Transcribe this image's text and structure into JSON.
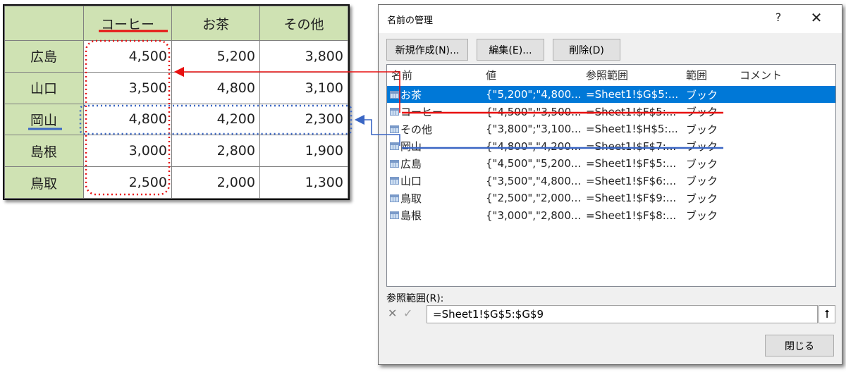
{
  "sheet": {
    "headers": [
      "",
      "コーヒー",
      "お茶",
      "その他"
    ],
    "rows": [
      {
        "label": "広島",
        "values": [
          "4,500",
          "5,200",
          "3,800"
        ]
      },
      {
        "label": "山口",
        "values": [
          "3,500",
          "4,800",
          "3,100"
        ]
      },
      {
        "label": "岡山",
        "values": [
          "4,800",
          "4,200",
          "2,300"
        ]
      },
      {
        "label": "島根",
        "values": [
          "3,000",
          "2,800",
          "1,900"
        ]
      },
      {
        "label": "鳥取",
        "values": [
          "2,500",
          "2,000",
          "1,300"
        ]
      }
    ]
  },
  "dialog": {
    "title": "名前の管理",
    "help": "?",
    "close_x": "✕",
    "buttons": {
      "new": "新規作成(N)...",
      "edit": "編集(E)...",
      "delete": "削除(D)"
    },
    "columns": {
      "name": "名前",
      "value": "値",
      "ref": "参照範囲",
      "scope": "範囲",
      "comment": "コメント"
    },
    "items": [
      {
        "name": "お茶",
        "value": "{\"5,200\";\"4,800...",
        "ref": "=Sheet1!$G$5:...",
        "scope": "ブック",
        "selected": true
      },
      {
        "name": "コーヒー",
        "value": "{\"4,500\";\"3,500...",
        "ref": "=Sheet1!$F$5:...",
        "scope": "ブック",
        "selected": false
      },
      {
        "name": "その他",
        "value": "{\"3,800\";\"3,100...",
        "ref": "=Sheet1!$H$5:...",
        "scope": "ブック",
        "selected": false
      },
      {
        "name": "岡山",
        "value": "{\"4,800\",\"4,200...",
        "ref": "=Sheet1!$F$7:...",
        "scope": "ブック",
        "selected": false
      },
      {
        "name": "広島",
        "value": "{\"4,500\",\"5,200...",
        "ref": "=Sheet1!$F$5:...",
        "scope": "ブック",
        "selected": false
      },
      {
        "name": "山口",
        "value": "{\"3,500\",\"4,800...",
        "ref": "=Sheet1!$F$6:...",
        "scope": "ブック",
        "selected": false
      },
      {
        "name": "鳥取",
        "value": "{\"2,500\",\"2,000...",
        "ref": "=Sheet1!$F$9:...",
        "scope": "ブック",
        "selected": false
      },
      {
        "name": "島根",
        "value": "{\"3,000\",\"2,800...",
        "ref": "=Sheet1!$F$8:...",
        "scope": "ブック",
        "selected": false
      }
    ],
    "ref_label": "参照範囲(R):",
    "ref_value": "=Sheet1!$G$5:$G$9",
    "close_button": "閉じる"
  },
  "colors": {
    "selection": "#0078d7",
    "header_fill": "#cfe2b3",
    "red_annot": "#e81010",
    "blue_annot": "#3a66c4"
  },
  "icons": {
    "cancel": "x-icon",
    "confirm": "check-icon",
    "collapse": "collapse-arrow-icon",
    "item": "table-name-icon"
  }
}
